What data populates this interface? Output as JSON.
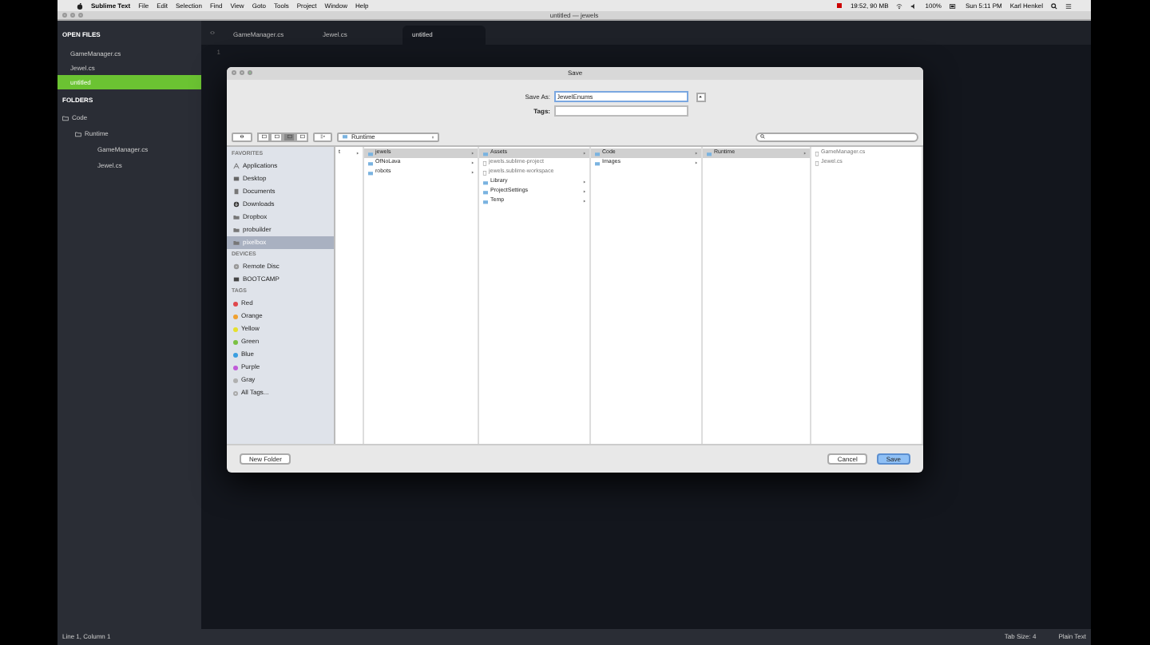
{
  "menu_bar": {
    "app": "Sublime Text",
    "items": [
      "File",
      "Edit",
      "Selection",
      "Find",
      "View",
      "Goto",
      "Tools",
      "Project",
      "Window",
      "Help"
    ],
    "status": [
      "19:52, 90 MB",
      "100%",
      "Sun 5:11 PM",
      "Karl Henkel"
    ]
  },
  "window": {
    "title": "untitled — jewels"
  },
  "sidebar": {
    "open_files_heading": "OPEN FILES",
    "open_files": [
      {
        "label": "GameManager.cs",
        "selected": false
      },
      {
        "label": "Jewel.cs",
        "selected": false
      },
      {
        "label": "untitled",
        "selected": true
      }
    ],
    "folders_heading": "FOLDERS",
    "folders": [
      {
        "label": "Code",
        "children": [
          {
            "label": "Runtime",
            "children": [
              {
                "label": "GameManager.cs"
              },
              {
                "label": "Jewel.cs"
              }
            ]
          }
        ]
      }
    ]
  },
  "tabs": [
    {
      "label": "GameManager.cs",
      "selected": false
    },
    {
      "label": "Jewel.cs",
      "selected": false
    },
    {
      "label": "untitled",
      "selected": true
    }
  ],
  "editor": {
    "line_numbers": [
      "1"
    ]
  },
  "dialog": {
    "title": "Save",
    "save_as_label": "Save As:",
    "save_as_value": "JewelEnums",
    "tags_label": "Tags:",
    "location": "Runtime",
    "sidebar": [
      {
        "heading": "FAVORITES",
        "items": [
          {
            "label": "Applications",
            "kind": "apps",
            "selected": false
          },
          {
            "label": "Desktop",
            "kind": "desktop",
            "selected": false
          },
          {
            "label": "Documents",
            "kind": "docs",
            "selected": false
          },
          {
            "label": "Downloads",
            "kind": "downloads",
            "selected": false
          },
          {
            "label": "Dropbox",
            "kind": "folder",
            "selected": false
          },
          {
            "label": "probuilder",
            "kind": "folder",
            "selected": false
          },
          {
            "label": "pixelbox",
            "kind": "folder",
            "selected": true
          }
        ]
      },
      {
        "heading": "DEVICES",
        "items": [
          {
            "label": "Remote Disc",
            "kind": "disc",
            "selected": false
          },
          {
            "label": "BOOTCAMP",
            "kind": "drive",
            "selected": false
          }
        ]
      },
      {
        "heading": "TAGS",
        "items": [
          {
            "label": "Red",
            "kind": "tag",
            "color": "#e0474c",
            "selected": false
          },
          {
            "label": "Orange",
            "kind": "tag",
            "color": "#f0a030",
            "selected": false
          },
          {
            "label": "Yellow",
            "kind": "tag",
            "color": "#e6e02c",
            "selected": false
          },
          {
            "label": "Green",
            "kind": "tag",
            "color": "#7ac142",
            "selected": false
          },
          {
            "label": "Blue",
            "kind": "tag",
            "color": "#3a9ee0",
            "selected": false
          },
          {
            "label": "Purple",
            "kind": "tag",
            "color": "#c05ad8",
            "selected": false
          },
          {
            "label": "Gray",
            "kind": "tag",
            "color": "#b0b0b0",
            "selected": false
          },
          {
            "label": "All Tags...",
            "kind": "alltags",
            "selected": false
          }
        ]
      }
    ],
    "columns": [
      [
        {
          "label": "t",
          "kind": "cut",
          "selected": false,
          "has_children": true
        }
      ],
      [
        {
          "label": "jewels",
          "kind": "folder",
          "selected": true,
          "has_children": true
        },
        {
          "label": "OfNoLava",
          "kind": "folder",
          "selected": false,
          "has_children": true
        },
        {
          "label": "robots",
          "kind": "folder",
          "selected": false,
          "has_children": true
        }
      ],
      [
        {
          "label": "Assets",
          "kind": "folder",
          "selected": true,
          "has_children": true
        },
        {
          "label": "jewels.sublime-project",
          "kind": "file",
          "selected": false,
          "has_children": false
        },
        {
          "label": "jewels.sublime-workspace",
          "kind": "file",
          "selected": false,
          "has_children": false
        },
        {
          "label": "Library",
          "kind": "folder",
          "selected": false,
          "has_children": true
        },
        {
          "label": "ProjectSettings",
          "kind": "folder",
          "selected": false,
          "has_children": true
        },
        {
          "label": "Temp",
          "kind": "folder",
          "selected": false,
          "has_children": true
        }
      ],
      [
        {
          "label": "Code",
          "kind": "folder",
          "selected": true,
          "has_children": true
        },
        {
          "label": "Images",
          "kind": "folder",
          "selected": false,
          "has_children": true
        }
      ],
      [
        {
          "label": "Runtime",
          "kind": "folder",
          "selected": true,
          "has_children": true
        }
      ],
      [
        {
          "label": "GameManager.cs",
          "kind": "file",
          "selected": false,
          "has_children": false
        },
        {
          "label": "Jewel.cs",
          "kind": "file",
          "selected": false,
          "has_children": false
        }
      ]
    ],
    "buttons": [
      {
        "label": "New Folder",
        "kind": "secondary"
      },
      {
        "label": "Cancel",
        "kind": "secondary"
      },
      {
        "label": "Save",
        "kind": "default"
      }
    ]
  },
  "status_bar": {
    "position": "Line 1, Column 1",
    "tab_size": "Tab Size: 4",
    "syntax": "Plain Text"
  }
}
